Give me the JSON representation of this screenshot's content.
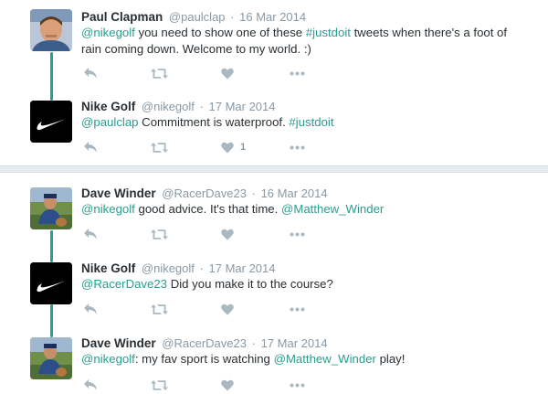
{
  "colors": {
    "link": "#2a9d8f",
    "thread_line": "#1fa590",
    "muted": "#8899a6",
    "text": "#292f33"
  },
  "icons": {
    "reply": "reply-arrow-icon",
    "retweet": "retweet-icon",
    "like": "heart-icon",
    "more": "more-dots-icon",
    "nike": "nike-swoosh-logo"
  },
  "conversations": [
    {
      "tweets": [
        {
          "name": "Paul Clapman",
          "handle": "@paulclap",
          "separator": "·",
          "date": "16 Mar 2014",
          "text_parts": [
            "@nikegolf",
            " you need to show one of these ",
            "#justdoit",
            " tweets when there's a foot of rain coming down.  Welcome to my world.  :)"
          ],
          "like_count": ""
        },
        {
          "name": "Nike Golf",
          "handle": "@nikegolf",
          "separator": "·",
          "date": "17 Mar 2014",
          "text_parts": [
            "@paulclap",
            " Commitment is waterproof. ",
            "#justdoit"
          ],
          "like_count": "1"
        }
      ]
    },
    {
      "tweets": [
        {
          "name": "Dave Winder",
          "handle": "@RacerDave23",
          "separator": "·",
          "date": "16 Mar 2014",
          "text_parts": [
            "@nikegolf",
            " good advice. It's that time.  ",
            "@Matthew_Winder"
          ],
          "like_count": ""
        },
        {
          "name": "Nike Golf",
          "handle": "@nikegolf",
          "separator": "·",
          "date": "17 Mar 2014",
          "text_parts": [
            "@RacerDave23",
            " Did you make it to the course?"
          ],
          "like_count": ""
        },
        {
          "name": "Dave Winder",
          "handle": "@RacerDave23",
          "separator": "·",
          "date": "17 Mar 2014",
          "text_parts": [
            "@nikegolf",
            ": my fav sport is watching ",
            "@Matthew_Winder",
            " play!"
          ],
          "like_count": ""
        }
      ]
    }
  ]
}
